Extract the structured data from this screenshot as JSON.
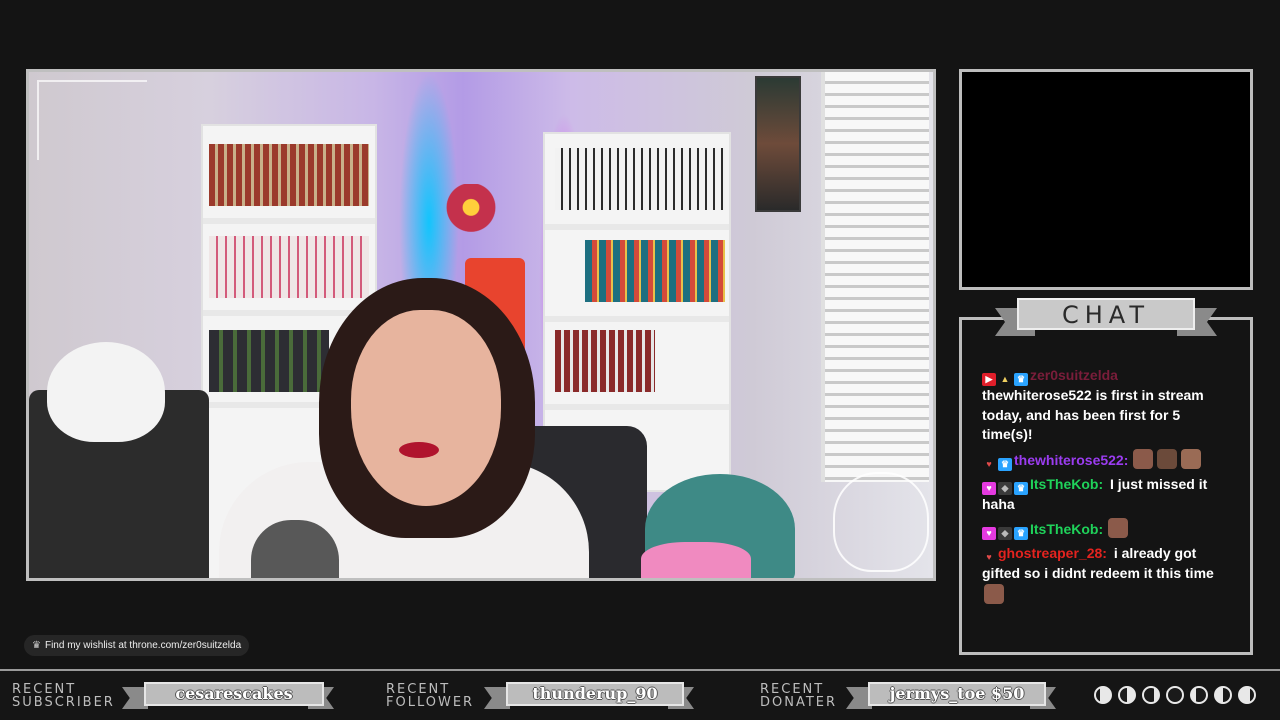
{
  "chat": {
    "title": "CHAT",
    "messages": [
      {
        "user": "zer0suitzelda",
        "user_color": "#7a1d3a",
        "badges": [
          "red",
          "tri",
          "blue"
        ],
        "text": "thewhiterose522 is first in stream today, and has been first for 5 time(s)!",
        "emotes": 0
      },
      {
        "user": "thewhiterose522",
        "user_color": "#9b3cf0",
        "badges": [
          "heart",
          "blue"
        ],
        "text": "",
        "emotes": 3
      },
      {
        "user": "ItsTheKob",
        "user_color": "#1fd25a",
        "badges": [
          "pink",
          "gray",
          "blue"
        ],
        "text": "I just missed it haha",
        "emotes": 0
      },
      {
        "user": "ItsTheKob",
        "user_color": "#1fd25a",
        "badges": [
          "pink",
          "gray",
          "blue"
        ],
        "text": "",
        "emotes": 1
      },
      {
        "user": "ghostreaper_28",
        "user_color": "#e4231f",
        "badges": [
          "heart"
        ],
        "text": "i already got gifted so i didnt redeem it this time",
        "emotes": 1
      }
    ]
  },
  "wishlist": {
    "text": "Find my wishlist at throne.com/zer0suitzelda"
  },
  "bottombar": {
    "subscriber": {
      "label_line1": "RECENT",
      "label_line2": "SUBSCRIBER",
      "value": "cesarescakes"
    },
    "follower": {
      "label_line1": "RECENT",
      "label_line2": "FOLLOWER",
      "value": "thunderup_90"
    },
    "donater": {
      "label_line1": "RECENT",
      "label_line2": "DONATER",
      "value": "jermys_toe $50"
    },
    "moon_phases": [
      "waxing-gibbous",
      "first-quarter",
      "waxing-crescent",
      "new",
      "waning-crescent",
      "last-quarter",
      "waning-gibbous"
    ]
  },
  "colors": {
    "frame": "#bdbdbd",
    "background": "#141414",
    "plate": "#bcbcbc"
  }
}
